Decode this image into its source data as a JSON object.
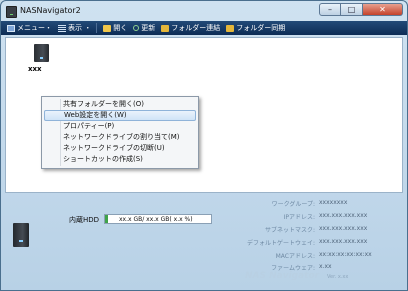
{
  "window": {
    "title": "NASNavigator2",
    "buttons": {
      "minimize": "–",
      "maximize": "□",
      "close": "✕"
    }
  },
  "toolbar": {
    "menu_label": "メニュー・",
    "view_label": "表示 ・",
    "open_label": "開く",
    "refresh_label": "更新",
    "folder_link_label": "フォルダー連結",
    "folder_sync_label": "フォルダー同期"
  },
  "device": {
    "name": "xxx"
  },
  "context_menu": {
    "items": [
      "共有フォルダーを開く(O)",
      "Web設定を開く(W)",
      "プロパティー(P)",
      "ネットワークドライブの割り当て(M)",
      "ネットワークドライブの切断(U)",
      "ショートカットの作成(S)"
    ],
    "selected_index": 1
  },
  "details": {
    "hdd_label": "内蔵HDD",
    "hdd_usage_text": "xx.x GB/ xx.x GB( x.x %)",
    "info": [
      {
        "label": "ワークグループ:",
        "value": "xxxxxxxx"
      },
      {
        "label": "IPアドレス:",
        "value": "xxx.xxx.xxx.xxx"
      },
      {
        "label": "サブネットマスク:",
        "value": "xxx.xxx.xxx.xxx"
      },
      {
        "label": "デフォルトゲートウェイ:",
        "value": "xxx.xxx.xxx.xxx"
      },
      {
        "label": "MACアドレス:",
        "value": "xx:xx:xx:xx:xx:xx"
      },
      {
        "label": "ファームウェア:",
        "value": "x.xx"
      }
    ],
    "brand": "NAS Navigator",
    "version": "Ver. x.xx"
  },
  "colors": {
    "toolbar_bg": "#0d2c55",
    "window_bg": "#c8dcea",
    "hdd_fill": "#3fa34a",
    "close_button": "#c4422b"
  },
  "icons": {
    "app": "nas-device-icon",
    "toolbar": [
      "menu-icon",
      "view-icon",
      "open-folder-icon",
      "refresh-icon",
      "folder-link-icon",
      "folder-sync-icon"
    ]
  }
}
